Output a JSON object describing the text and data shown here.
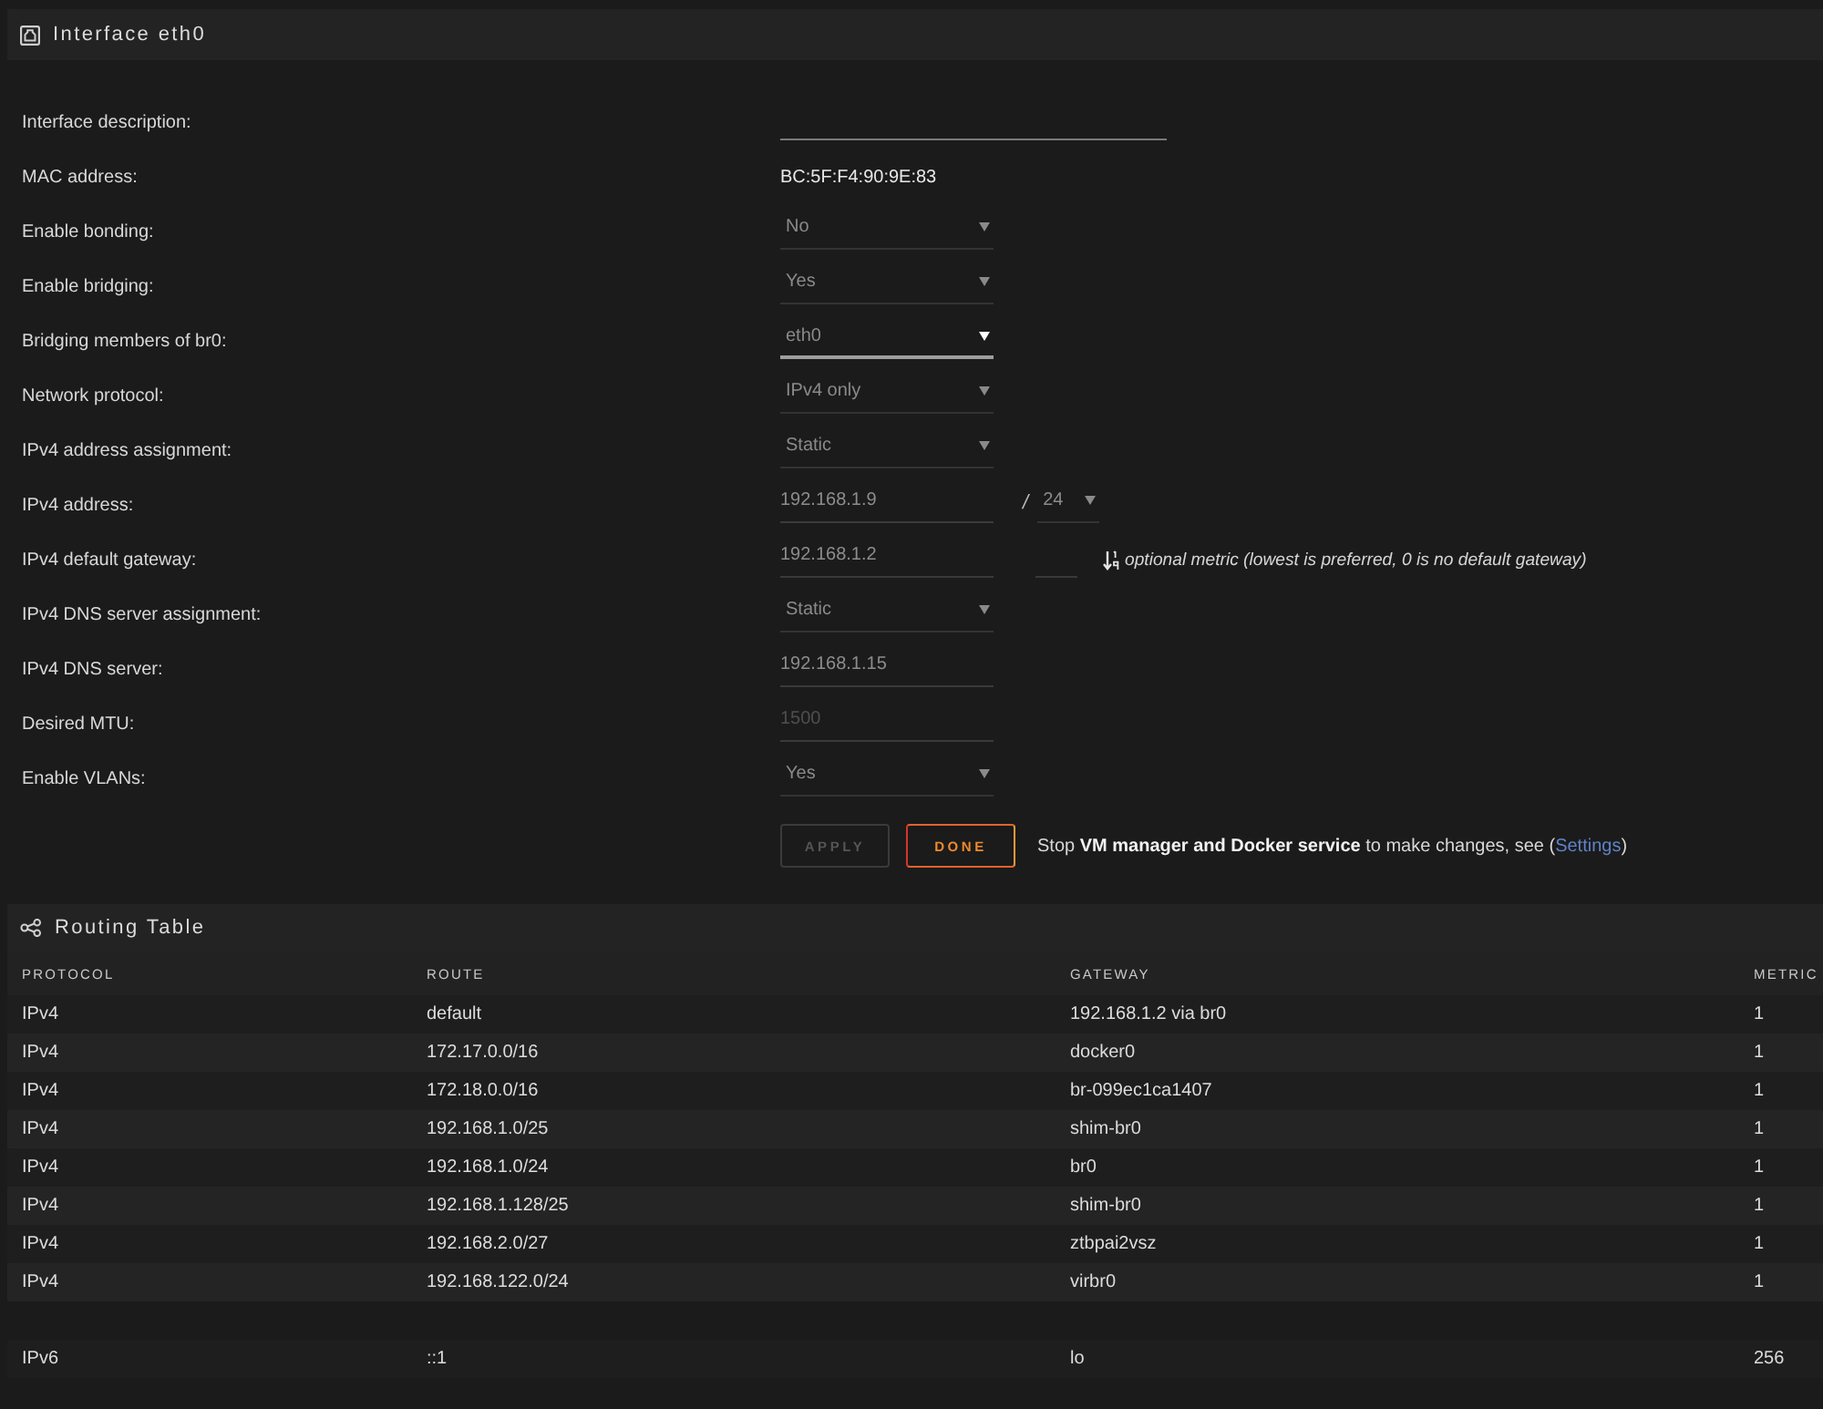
{
  "panel": {
    "title": "Interface eth0"
  },
  "form": {
    "rows": [
      {
        "label": "Interface description:",
        "controls": [
          {
            "kind": "line_input",
            "disabled": false
          }
        ]
      },
      {
        "label": "MAC address:",
        "controls": [
          {
            "kind": "static",
            "value": "BC:5F:F4:90:9E:83"
          }
        ]
      },
      {
        "label": "Enable bonding:",
        "controls": [
          {
            "kind": "select",
            "value": "No",
            "disabled": true
          }
        ]
      },
      {
        "label": "Enable bridging:",
        "controls": [
          {
            "kind": "select",
            "value": "Yes",
            "disabled": true
          }
        ]
      },
      {
        "label": "Bridging members of br0:",
        "controls": [
          {
            "kind": "select",
            "value": "eth0",
            "disabled": false
          }
        ]
      },
      {
        "label": "Network protocol:",
        "controls": [
          {
            "kind": "select",
            "value": "IPv4 only",
            "disabled": true
          }
        ]
      },
      {
        "label": "IPv4 address assignment:",
        "controls": [
          {
            "kind": "select",
            "value": "Static",
            "disabled": true
          }
        ]
      },
      {
        "label": "IPv4 address:",
        "controls": [
          {
            "kind": "input",
            "value": "192.168.1.9",
            "disabled": true
          },
          {
            "kind": "separator",
            "value": "/"
          },
          {
            "kind": "mini_select",
            "value": "24",
            "disabled": true
          }
        ]
      },
      {
        "label": "IPv4 default gateway:",
        "controls": [
          {
            "kind": "input",
            "value": "192.168.1.2",
            "disabled": true
          },
          {
            "kind": "mini_input",
            "disabled": true
          },
          {
            "kind": "note",
            "value": "optional metric (lowest is preferred, 0 is no default gateway)"
          }
        ]
      },
      {
        "label": "IPv4 DNS server assignment:",
        "controls": [
          {
            "kind": "select",
            "value": "Static",
            "disabled": true
          }
        ]
      },
      {
        "label": "IPv4 DNS server:",
        "controls": [
          {
            "kind": "input",
            "value": "192.168.1.15",
            "disabled": true
          }
        ]
      },
      {
        "label": "Desired MTU:",
        "controls": [
          {
            "kind": "input",
            "placeholder": "1500",
            "disabled": true
          }
        ]
      },
      {
        "label": "Enable VLANs:",
        "controls": [
          {
            "kind": "select",
            "value": "Yes",
            "disabled": true
          }
        ]
      }
    ]
  },
  "actions": {
    "buttons": [
      {
        "label": "APPLY",
        "disabled": true
      },
      {
        "label": "DONE",
        "disabled": false
      }
    ],
    "notice": {
      "text": "Stop **VM manager and Docker service** to make changes, see (",
      "link": "Settings",
      "text_after": ")"
    }
  },
  "routing": {
    "title": "Routing Table",
    "columns": [
      "PROTOCOL",
      "ROUTE",
      "GATEWAY",
      "METRIC"
    ],
    "groups": [
      {
        "rows": [
          [
            "IPv4",
            "default",
            "192.168.1.2 via br0",
            "1"
          ],
          [
            "IPv4",
            "172.17.0.0/16",
            "docker0",
            "1"
          ],
          [
            "IPv4",
            "172.18.0.0/16",
            "br-099ec1ca1407",
            "1"
          ],
          [
            "IPv4",
            "192.168.1.0/25",
            "shim-br0",
            "1"
          ],
          [
            "IPv4",
            "192.168.1.0/24",
            "br0",
            "1"
          ],
          [
            "IPv4",
            "192.168.1.128/25",
            "shim-br0",
            "1"
          ],
          [
            "IPv4",
            "192.168.2.0/27",
            "ztbpai2vsz",
            "1"
          ],
          [
            "IPv4",
            "192.168.122.0/24",
            "virbr0",
            "1"
          ]
        ]
      },
      {
        "rows": [
          [
            "IPv6",
            "::1",
            "lo",
            "256"
          ]
        ]
      }
    ]
  }
}
